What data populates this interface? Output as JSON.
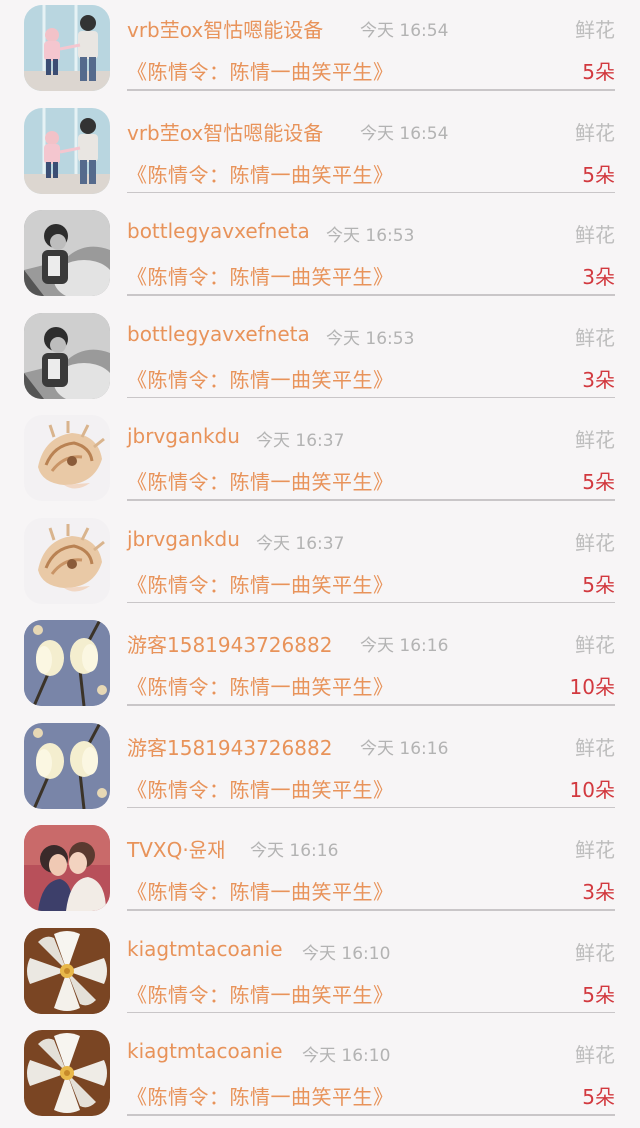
{
  "items": [
    {
      "username": "vrb茔ox智怙嗯能设备",
      "time": "今天 16:54",
      "gift_type": "鲜花",
      "title": "《陈情令：陈情一曲笑平生》",
      "count": "5朵",
      "avatar_icon": "avatar-children-photo-icon"
    },
    {
      "username": "vrb茔ox智怙嗯能设备",
      "time": "今天 16:54",
      "gift_type": "鲜花",
      "title": "《陈情令：陈情一曲笑平生》",
      "count": "5朵",
      "avatar_icon": "avatar-children-photo-icon"
    },
    {
      "username": "bottlegyavxefneta",
      "time": "今天 16:53",
      "gift_type": "鲜花",
      "title": "《陈情令：陈情一曲笑平生》",
      "count": "3朵",
      "avatar_icon": "avatar-bw-child-photo-icon"
    },
    {
      "username": "bottlegyavxefneta",
      "time": "今天 16:53",
      "gift_type": "鲜花",
      "title": "《陈情令：陈情一曲笑平生》",
      "count": "3朵",
      "avatar_icon": "avatar-bw-child-photo-icon"
    },
    {
      "username": "jbrvgankdu",
      "time": "今天 16:37",
      "gift_type": "鲜花",
      "title": "《陈情令：陈情一曲笑平生》",
      "count": "5朵",
      "avatar_icon": "avatar-seashell-icon"
    },
    {
      "username": "jbrvgankdu",
      "time": "今天 16:37",
      "gift_type": "鲜花",
      "title": "《陈情令：陈情一曲笑平生》",
      "count": "5朵",
      "avatar_icon": "avatar-seashell-icon"
    },
    {
      "username": "游客1581943726882",
      "time": "今天 16:16",
      "gift_type": "鲜花",
      "title": "《陈情令：陈情一曲笑平生》",
      "count": "10朵",
      "avatar_icon": "avatar-magnolia-icon"
    },
    {
      "username": "游客1581943726882",
      "time": "今天 16:16",
      "gift_type": "鲜花",
      "title": "《陈情令：陈情一曲笑平生》",
      "count": "10朵",
      "avatar_icon": "avatar-magnolia-icon"
    },
    {
      "username": "TVXQ·윤재",
      "time": "今天 16:16",
      "gift_type": "鲜花",
      "title": "《陈情令：陈情一曲笑平生》",
      "count": "3朵",
      "avatar_icon": "avatar-couple-photo-icon"
    },
    {
      "username": "kiagtmtacoanie",
      "time": "今天 16:10",
      "gift_type": "鲜花",
      "title": "《陈情令：陈情一曲笑平生》",
      "count": "5朵",
      "avatar_icon": "avatar-white-flower-icon"
    },
    {
      "username": "kiagtmtacoanie",
      "time": "今天 16:10",
      "gift_type": "鲜花",
      "title": "《陈情令：陈情一曲笑平生》",
      "count": "5朵",
      "avatar_icon": "avatar-white-flower-icon"
    }
  ],
  "colors": {
    "username": "#e8935a",
    "title": "#e8935a",
    "count": "#d2393f",
    "muted": "#b3b3b3",
    "background": "#f7f5f6"
  }
}
